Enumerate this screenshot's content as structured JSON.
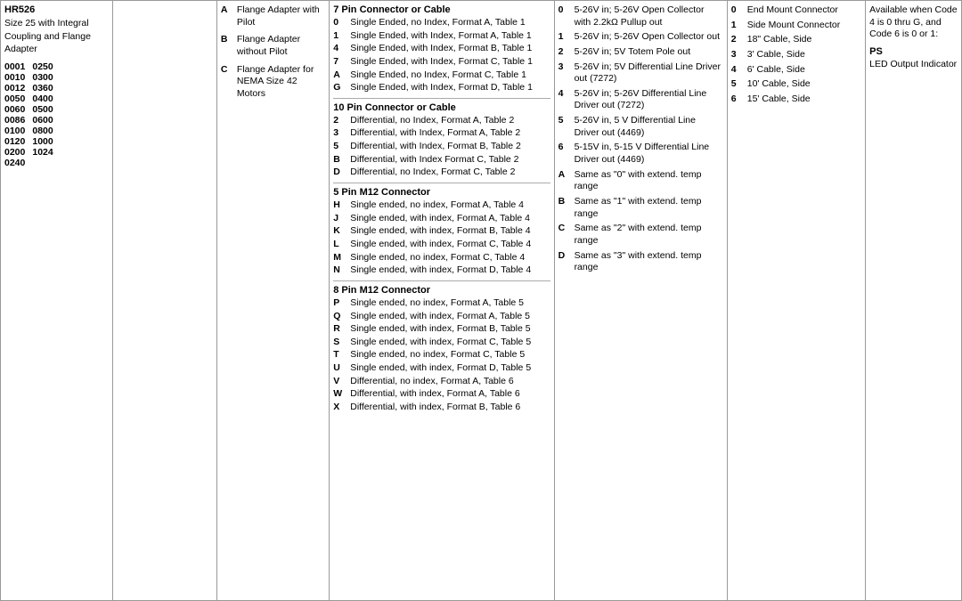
{
  "model": {
    "name": "HR526",
    "description": "Size 25 with Integral Coupling and Flange Adapter",
    "sizes": [
      {
        "left": "0001",
        "right": "0250"
      },
      {
        "left": "0010",
        "right": "0300"
      },
      {
        "left": "0012",
        "right": "0360"
      },
      {
        "left": "0050",
        "right": "0400"
      },
      {
        "left": "0060",
        "right": "0500"
      },
      {
        "left": "0086",
        "right": "0600"
      },
      {
        "left": "0100",
        "right": "0800"
      },
      {
        "left": "0120",
        "right": "1000"
      },
      {
        "left": "0200",
        "right": "1024"
      },
      {
        "left": "0240",
        "right": ""
      }
    ]
  },
  "mount": {
    "items": [
      {
        "code": "A",
        "label": "Flange Adapter with Pilot"
      },
      {
        "code": "B",
        "label": "Flange Adapter without Pilot"
      },
      {
        "code": "C",
        "label": "Flange Adapter for NEMA Size 42 Motors"
      }
    ]
  },
  "connector": {
    "sections": [
      {
        "title": "7 Pin Connector or Cable",
        "items": [
          {
            "code": "0",
            "text": "Single Ended, no Index, Format A, Table 1"
          },
          {
            "code": "1",
            "text": "Single Ended, with Index, Format A, Table 1"
          },
          {
            "code": "4",
            "text": "Single Ended, with Index, Format B, Table 1"
          },
          {
            "code": "7",
            "text": "Single Ended, with Index, Format C, Table 1"
          },
          {
            "code": "A",
            "text": "Single Ended, no Index, Format C, Table 1"
          },
          {
            "code": "G",
            "text": "Single Ended, with Index, Format D, Table 1"
          }
        ]
      },
      {
        "title": "10 Pin Connector or Cable",
        "items": [
          {
            "code": "2",
            "text": "Differential, no Index, Format A, Table 2"
          },
          {
            "code": "3",
            "text": "Differential, with Index, Format A, Table 2"
          },
          {
            "code": "5",
            "text": "Differential, with Index, Format B, Table 2"
          },
          {
            "code": "B",
            "text": "Differential, with Index Format C, Table 2"
          },
          {
            "code": "D",
            "text": "Differential, no Index, Format C, Table 2"
          }
        ]
      },
      {
        "title": "5 Pin M12 Connector",
        "items": [
          {
            "code": "H",
            "text": "Single ended, no index, Format A, Table 4"
          },
          {
            "code": "J",
            "text": "Single ended, with index, Format A, Table 4"
          },
          {
            "code": "K",
            "text": "Single ended, with index, Format B, Table 4"
          },
          {
            "code": "L",
            "text": "Single ended, with index, Format C, Table 4"
          },
          {
            "code": "M",
            "text": "Single ended, no index, Format C, Table 4"
          },
          {
            "code": "N",
            "text": "Single ended, with index, Format D, Table 4"
          }
        ]
      },
      {
        "title": "8 Pin M12 Connector",
        "items": [
          {
            "code": "P",
            "text": "Single ended, no index, Format A, Table 5"
          },
          {
            "code": "Q",
            "text": "Single ended, with index, Format A, Table 5"
          },
          {
            "code": "R",
            "text": "Single ended, with index, Format B, Table 5"
          },
          {
            "code": "S",
            "text": "Single ended, with index, Format C, Table 5"
          },
          {
            "code": "T",
            "text": "Single ended, no index, Format C, Table 5"
          },
          {
            "code": "U",
            "text": "Single ended, with index, Format D, Table 5"
          },
          {
            "code": "V",
            "text": "Differential, no index, Format A, Table 6"
          },
          {
            "code": "W",
            "text": "Differential, with index, Format A, Table 6"
          },
          {
            "code": "X",
            "text": "Differential, with index, Format B, Table 6"
          }
        ]
      }
    ]
  },
  "output": {
    "items": [
      {
        "code": "0",
        "text": "5-26V in; 5-26V Open Collector with 2.2kΩ Pullup out"
      },
      {
        "code": "1",
        "text": "5-26V in; 5-26V Open Collector out"
      },
      {
        "code": "2",
        "text": "5-26V in; 5V Totem Pole out"
      },
      {
        "code": "3",
        "text": "5-26V in; 5V Differential Line Driver out (7272)"
      },
      {
        "code": "4",
        "text": "5-26V in; 5-26V Differential Line Driver out (7272)"
      },
      {
        "code": "5",
        "text": "5-26V in, 5 V Differential Line Driver out (4469)"
      },
      {
        "code": "6",
        "text": "5-15V in, 5-15 V Differential Line Driver out (4469)"
      },
      {
        "code": "A",
        "text": "Same as \"0\" with extend. temp range"
      },
      {
        "code": "B",
        "text": "Same as \"1\" with extend. temp range"
      },
      {
        "code": "C",
        "text": "Same as \"2\" with extend. temp range"
      },
      {
        "code": "D",
        "text": "Same as \"3\" with extend. temp range"
      }
    ]
  },
  "cable": {
    "mount_items": [
      {
        "code": "0",
        "text": "End Mount Connector"
      },
      {
        "code": "1",
        "text": "Side Mount Connector"
      },
      {
        "code": "2",
        "text": "18\" Cable, Side"
      },
      {
        "code": "3",
        "text": "3' Cable, Side"
      },
      {
        "code": "4",
        "text": "6' Cable, Side"
      },
      {
        "code": "5",
        "text": "10' Cable, Side"
      },
      {
        "code": "6",
        "text": "15' Cable, Side"
      }
    ]
  },
  "code": {
    "note": "Available when Code 4 is 0 thru G, and Code 6 is 0 or 1:",
    "ps_label": "PS",
    "ps_text": "LED Output Indicator"
  }
}
